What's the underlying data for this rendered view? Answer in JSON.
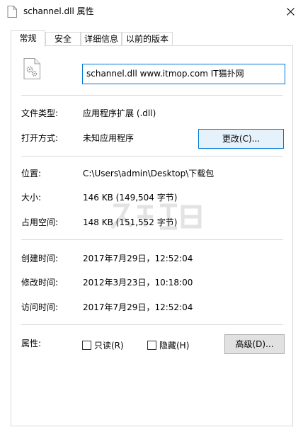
{
  "window": {
    "title": "schannel.dll 属性"
  },
  "tabs": [
    {
      "label": "常规",
      "active": true
    },
    {
      "label": "安全",
      "active": false
    },
    {
      "label": "详细信息",
      "active": false
    },
    {
      "label": "以前的版本",
      "active": false
    }
  ],
  "general": {
    "file_name": "schannel.dll www.itmop.com IT猫扑网",
    "file_type_label": "文件类型:",
    "file_type_value": "应用程序扩展 (.dll)",
    "opens_with_label": "打开方式:",
    "opens_with_value": "未知应用程序",
    "change_button": "更改(C)...",
    "location_label": "位置:",
    "location_value": "C:\\Users\\admin\\Desktop\\下载包",
    "size_label": "大小:",
    "size_value": "146 KB (149,504 字节)",
    "size_on_disk_label": "占用空间:",
    "size_on_disk_value": "148 KB (151,552 字节)",
    "created_label": "创建时间:",
    "created_value": "2017年7月29日，12:52:04",
    "modified_label": "修改时间:",
    "modified_value": "2012年3月23日，10:18:00",
    "accessed_label": "访问时间:",
    "accessed_value": "2017年7月29日，12:52:04",
    "attributes_label": "属性:",
    "readonly_label": "只读(R)",
    "hidden_label": "隐藏(H)",
    "advanced_button": "高级(D)..."
  },
  "colors": {
    "accent": "#0078d7",
    "border": "#d9d9d9",
    "button_bg": "#e1e1e1"
  },
  "icons": {
    "title": "file-icon",
    "close": "close-icon",
    "file": "dll-gear-file-icon"
  }
}
